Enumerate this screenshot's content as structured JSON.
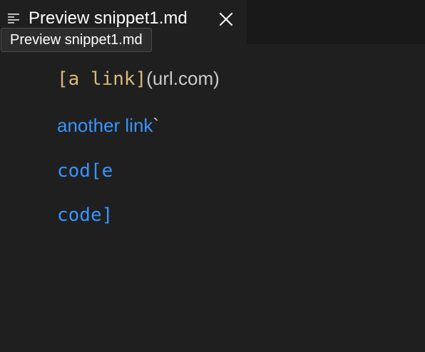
{
  "tab": {
    "title": "Preview snippet1.md",
    "icon": "preview-icon",
    "close_icon": "close-icon",
    "tooltip": "Preview snippet1.md"
  },
  "content": {
    "line1_code": "[a link]",
    "line1_text": "(url.com)",
    "line2_link": "another link",
    "line2_tail": "`",
    "line3": "cod[e",
    "line4": "code]"
  },
  "colors": {
    "background": "#1f1f1f",
    "tabbar": "#181818",
    "link_blue": "#3794ff",
    "code_gold": "#d7ba7d",
    "text_gray": "#cccccc"
  }
}
